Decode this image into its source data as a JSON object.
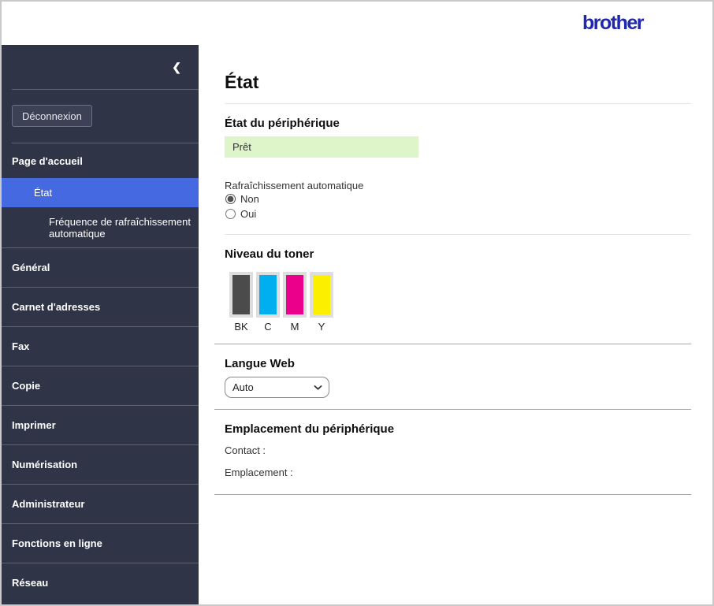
{
  "header": {
    "logo_text": "brother"
  },
  "icons": {
    "sidebar_collapse": "chevron-left",
    "web_language_dropdown": "chevron-down"
  },
  "colors": {
    "logo_blue": "#1e27ad",
    "sidebar_bg": "#2f3447",
    "active_item_blue": "#4569e0",
    "status_ok_green": "#ddf5c8",
    "outer_border": "#c9c9c9"
  },
  "sidebar": {
    "collapse_glyph": "❮",
    "logout_label": "Déconnexion",
    "home": {
      "label": "Page d'accueil",
      "sub": [
        {
          "label": "État",
          "active": true
        },
        {
          "label": "Fréquence de rafraîchissement automatique",
          "active": false
        }
      ]
    },
    "items": [
      {
        "label": "Général"
      },
      {
        "label": "Carnet d'adresses"
      },
      {
        "label": "Fax"
      },
      {
        "label": "Copie"
      },
      {
        "label": "Imprimer"
      },
      {
        "label": "Numérisation"
      },
      {
        "label": "Administrateur"
      },
      {
        "label": "Fonctions en ligne"
      },
      {
        "label": "Réseau"
      }
    ]
  },
  "main": {
    "title": "État",
    "device_status": {
      "heading": "État du périphérique",
      "value": "Prêt"
    },
    "auto_refresh": {
      "label": "Rafraîchissement automatique",
      "options": [
        {
          "label": "Non",
          "selected": true
        },
        {
          "label": "Oui",
          "selected": false
        }
      ]
    },
    "toner": {
      "heading": "Niveau du toner",
      "cartridges": [
        {
          "label": "BK",
          "color": "#4b4b4b",
          "level_percent": 100
        },
        {
          "label": "C",
          "color": "#00aff0",
          "level_percent": 100
        },
        {
          "label": "M",
          "color": "#eb008b",
          "level_percent": 100
        },
        {
          "label": "Y",
          "color": "#fcf000",
          "level_percent": 100
        }
      ]
    },
    "web_language": {
      "heading": "Langue Web",
      "selected": "Auto"
    },
    "device_location": {
      "heading": "Emplacement du périphérique",
      "contact_label": "Contact :",
      "location_label": "Emplacement :"
    }
  }
}
